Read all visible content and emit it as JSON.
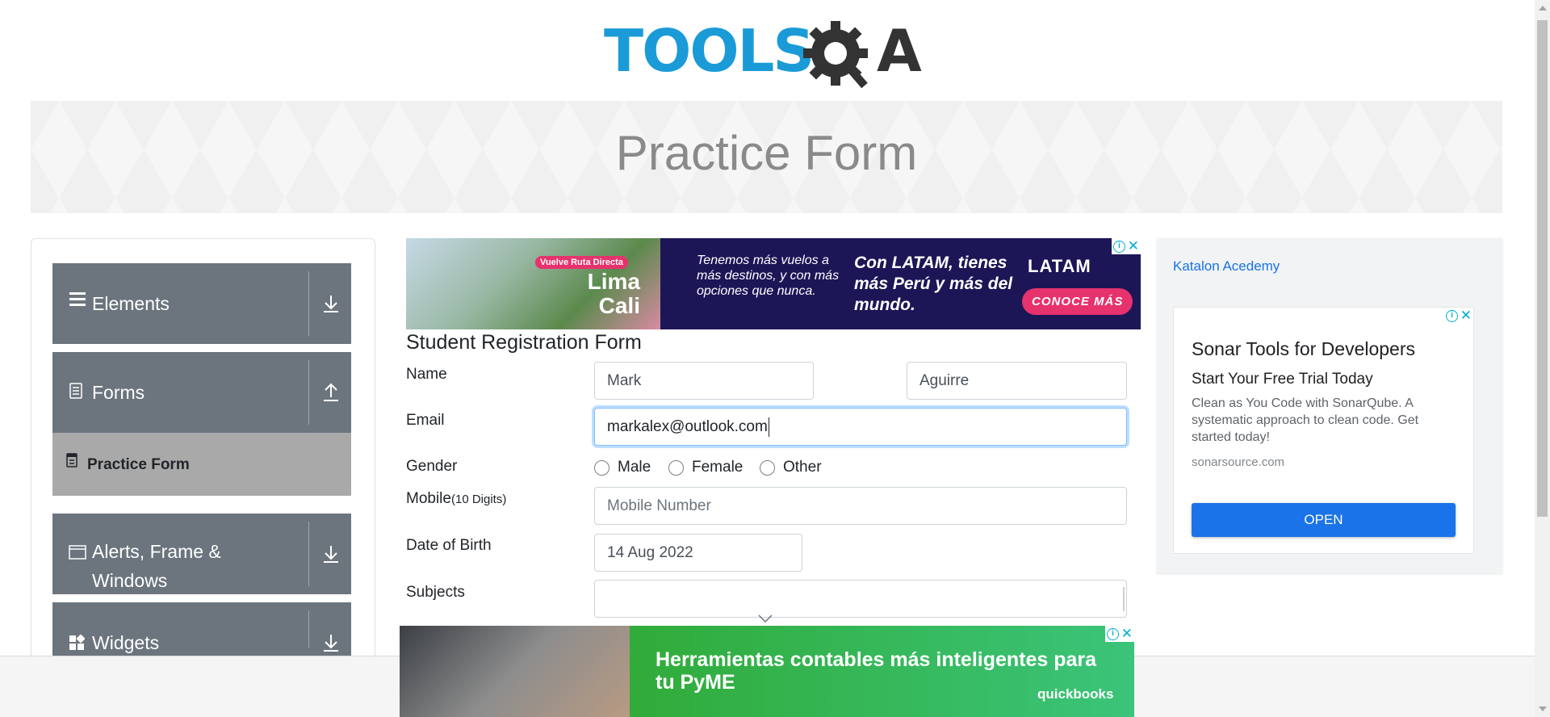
{
  "logo": {
    "left_text": "TOOLS",
    "right_text": "QA",
    "primary_color": "#1a9bd7",
    "secondary_color": "#333333"
  },
  "banner": {
    "title": "Practice Form"
  },
  "sidebar": {
    "groups": [
      {
        "label": "Elements",
        "icon": "hamburger-icon",
        "arrow": "download-arrow-icon"
      },
      {
        "label": "Forms",
        "icon": "document-icon",
        "arrow": "upload-arrow-icon"
      },
      {
        "label": "Alerts, Frame &",
        "label2": "Windows",
        "icon": "window-icon",
        "arrow": "download-arrow-icon"
      },
      {
        "label": "Widgets",
        "icon": "widgets-icon",
        "arrow": "download-arrow-icon"
      }
    ],
    "active_item": {
      "label": "Practice Form",
      "icon": "form-icon"
    }
  },
  "ad_top": {
    "tag": "Vuelve Ruta Directa",
    "city1": "Lima",
    "city2": "Cali",
    "text1": "Tenemos más vuelos a más destinos, y con más opciones que nunca.",
    "text2": "Con LATAM, tienes más Perú y más del mundo.",
    "brand": "LATAM",
    "cta": "CONOCE MÁS"
  },
  "form": {
    "title": "Student Registration Form",
    "labels": {
      "name": "Name",
      "email": "Email",
      "gender": "Gender",
      "mobile": "Mobile",
      "mobile_hint": "(10 Digits)",
      "dob": "Date of Birth",
      "subjects": "Subjects"
    },
    "first_name": "Mark",
    "last_name": "Aguirre",
    "email": "markalex@outlook.com",
    "gender_options": [
      "Male",
      "Female",
      "Other"
    ],
    "mobile_placeholder": "Mobile Number",
    "dob": "14 Aug 2022",
    "subjects": ""
  },
  "right_ad": {
    "katalon_alt": "Katalon Acedemy",
    "headline": "Sonar Tools for Developers",
    "subheadline": "Start Your Free Trial Today",
    "body": "Clean as You Code with SonarQube. A systematic approach to clean code. Get started today!",
    "url": "sonarsource.com",
    "button": "OPEN"
  },
  "ad_bottom": {
    "message": "Herramientas contables más inteligentes para tu PyME",
    "brand": "quickbooks"
  }
}
